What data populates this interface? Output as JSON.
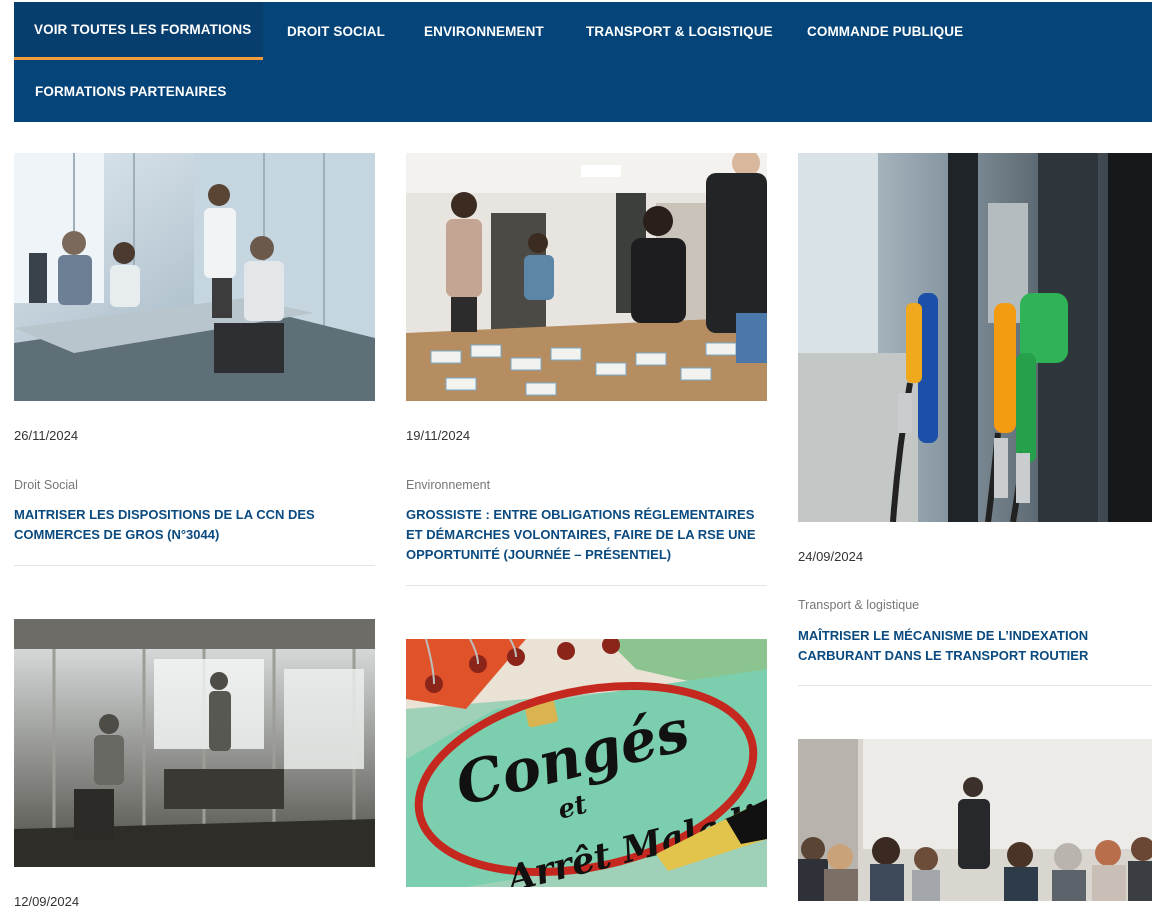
{
  "nav": {
    "items": [
      {
        "label": "VOIR TOUTES LES FORMATIONS"
      },
      {
        "label": "DROIT SOCIAL"
      },
      {
        "label": "ENVIRONNEMENT"
      },
      {
        "label": "TRANSPORT & LOGISTIQUE"
      },
      {
        "label": "COMMANDE PUBLIQUE"
      },
      {
        "label": "FORMATIONS PARTENAIRES"
      }
    ],
    "active_index": 0,
    "colors": {
      "background": "#054479",
      "active_underline": "#f39c3c",
      "text": "#ffffff"
    }
  },
  "cards": [
    {
      "date": "26/11/2024",
      "category": "Droit Social",
      "title": "MAITRISER LES DISPOSITIONS DE LA CCN DES COMMERCES DE GROS (N°3044)"
    },
    {
      "date": "19/11/2024",
      "category": "Environnement",
      "title": "GROSSISTE : ENTRE OBLIGATIONS RÉGLEMENTAIRES ET DÉMARCHES VOLONTAIRES, FAIRE DE LA RSE UNE OPPORTUNITÉ (JOURNÉE – PRÉSENTIEL)"
    },
    {
      "date": "24/09/2024",
      "category": "Transport & logistique",
      "title": "MAÎTRISER LE MÉCANISME DE L’INDEXATION CARBURANT DANS LE TRANSPORT ROUTIER"
    },
    {
      "date": "12/09/2024"
    },
    {
      "image_text": {
        "line1": "Congés",
        "line2": "et",
        "line3": "Arrêt Maladie"
      }
    },
    {}
  ],
  "colors": {
    "title": "#0a4a7f",
    "category": "#777777",
    "date": "#333333"
  }
}
